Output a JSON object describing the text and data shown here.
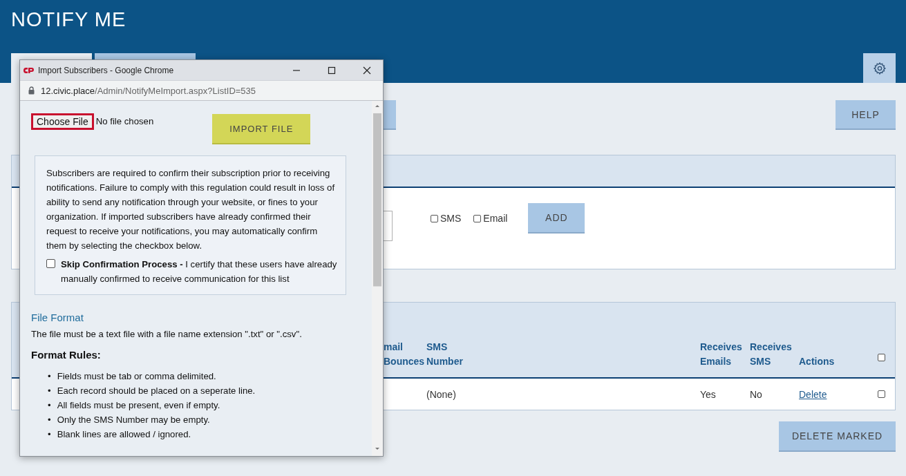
{
  "page": {
    "title": "NOTIFY ME",
    "tabs": [
      {
        "selected": true
      },
      {
        "selected": false
      }
    ],
    "help_button": "HELP",
    "subscribe_panel": {
      "options": [
        {
          "label": "SMS",
          "checked": false
        },
        {
          "label": "Email",
          "checked": false
        }
      ],
      "add_button": "ADD"
    },
    "subscribers_table": {
      "columns": [
        "mail Bounces",
        "SMS Number",
        "Receives Emails",
        "Receives SMS",
        "Actions"
      ],
      "select_all": {
        "checked": false
      },
      "rows": [
        {
          "cells": [
            "",
            "(None)",
            "Yes",
            "No"
          ],
          "action": "Delete",
          "checked": false
        }
      ]
    },
    "delete_button": "DELETE MARKED"
  },
  "popup": {
    "window_title": "Import Subscribers - Google Chrome",
    "url_host": "12.civic.place",
    "url_path": "/Admin/NotifyMeImport.aspx?ListID=535",
    "choose_file": "Choose File",
    "file_status": "No file chosen",
    "import_button": "IMPORT FILE",
    "notice": "Subscribers are required to confirm their subscription prior to receiving notifications. Failure to comply with this regulation could result in loss of ability to send any notification through your website, or fines to your organization. If imported subscribers have already confirmed their request to receive your notifications, you may automatically confirm them by selecting the checkbox below.",
    "skip_confirmation": {
      "checked": false,
      "text": "**Skip Confirmation Process -** I certify that these users have already manually confirmed to receive communication for this list"
    },
    "section_title": "File Format",
    "section_text": "The file must be a text file with a file name extension \".txt\" or \".csv\".",
    "rules_title": "Format Rules:",
    "rule_marker": "•",
    "rules": [
      "Fields must be tab or comma delimited.",
      "Each record should be placed on a seperate line.",
      "All fields must be present, even if empty.",
      "Only the SMS Number may be empty.",
      "Blank lines are allowed / ignored."
    ]
  }
}
